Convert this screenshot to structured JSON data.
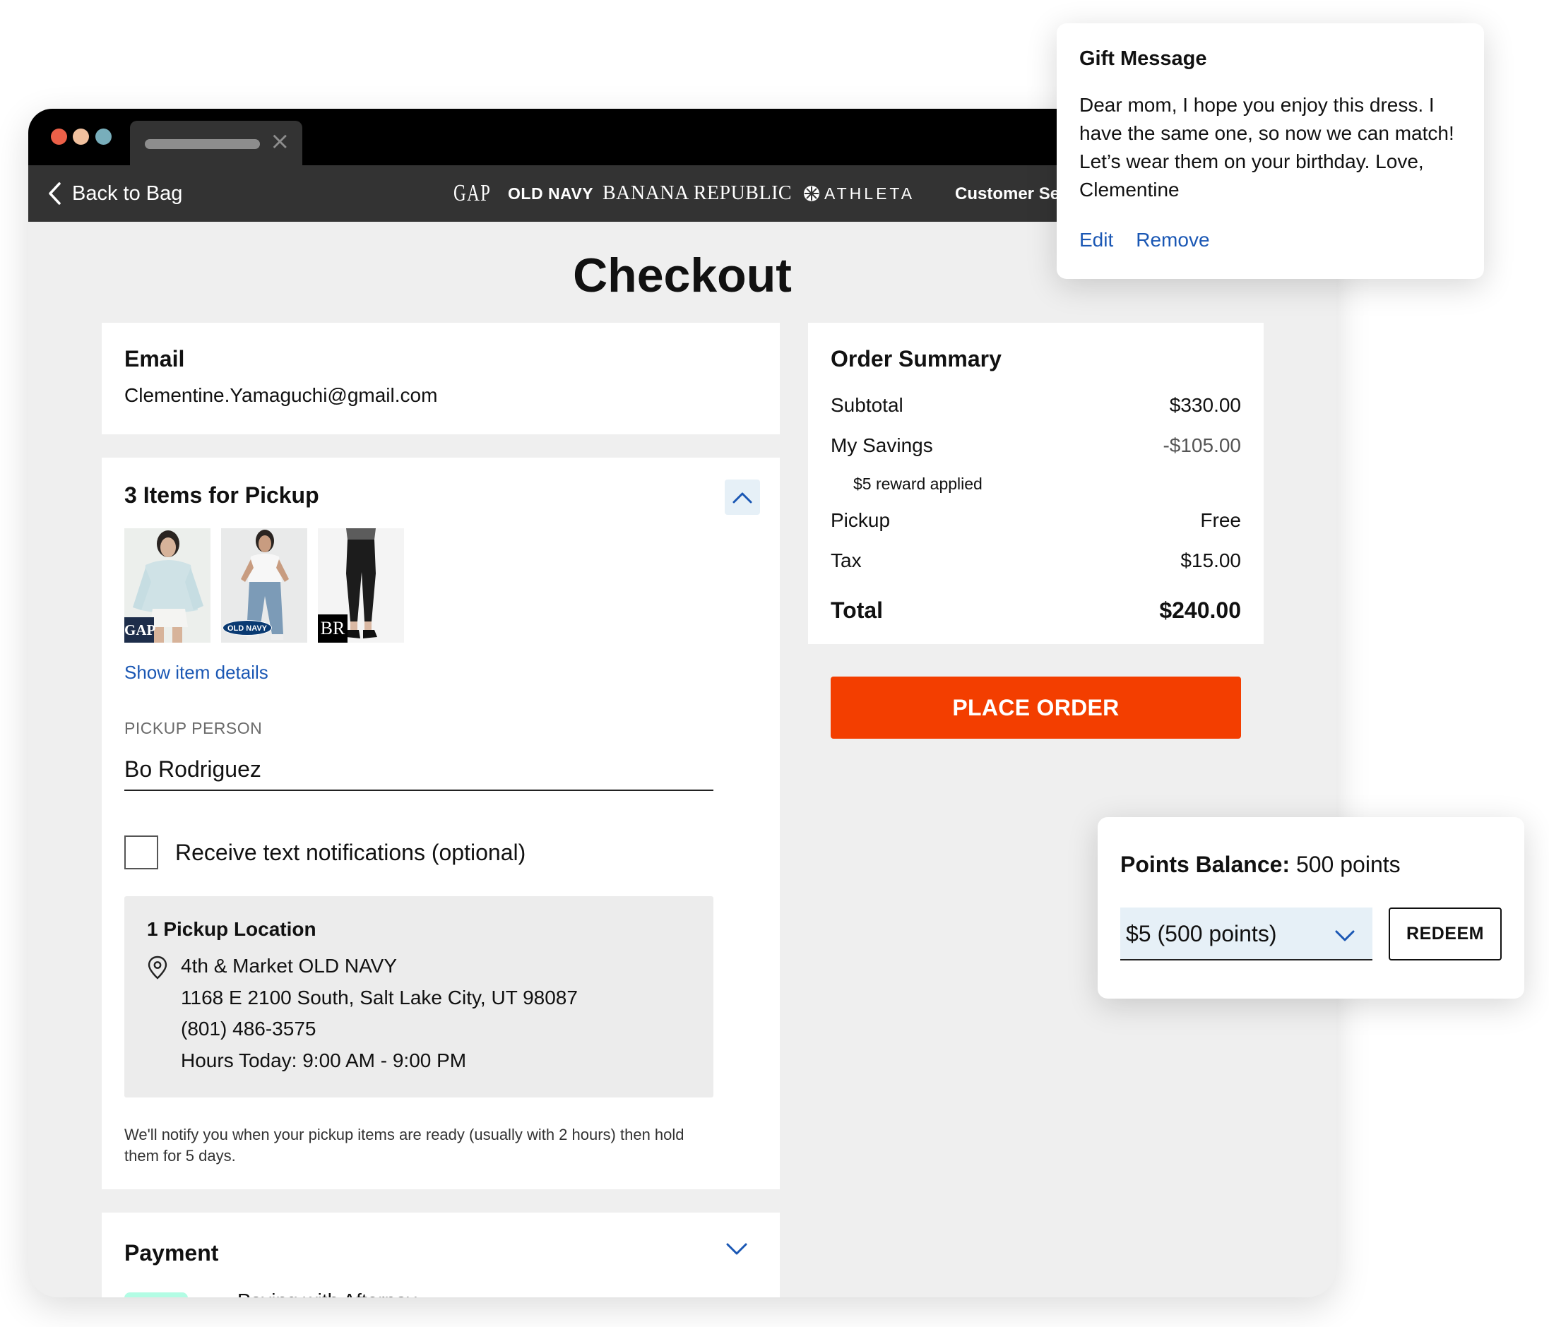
{
  "browser": {
    "tab_close_icon": "close-icon"
  },
  "nav": {
    "back_label": "Back to Bag",
    "brands": {
      "gap": "GAP",
      "old_navy": "OLD NAVY",
      "banana_republic": "BANANA REPUBLIC",
      "athleta": "ATHLETA"
    },
    "customer_service": "Customer Ser"
  },
  "page": {
    "title": "Checkout"
  },
  "email": {
    "heading": "Email",
    "value": "Clementine.Yamaguchi@gmail.com"
  },
  "pickup": {
    "heading": "3 Items for Pickup",
    "items": [
      {
        "brand_badge": "GAP"
      },
      {
        "brand_badge": "OLD NAVY"
      },
      {
        "brand_badge": "BR"
      }
    ],
    "show_details": "Show item details",
    "person_label": "PICKUP PERSON",
    "person_value": "Bo Rodriguez",
    "text_notifications_label": "Receive text notifications (optional)",
    "text_notifications_checked": false,
    "location": {
      "title": "1 Pickup Location",
      "store": "4th & Market OLD NAVY",
      "address": "1168 E 2100 South, Salt Lake City, UT 98087",
      "phone": "(801) 486-3575",
      "hours": "Hours Today: 9:00 AM - 9:00 PM"
    },
    "notice": "We'll notify you when your pickup items are ready (usually with 2 hours) then hold them for 5 days."
  },
  "payment": {
    "heading": "Payment",
    "afterpay_logo": "afterpay",
    "method": "Paying with Afterpay"
  },
  "summary": {
    "heading": "Order Summary",
    "subtotal_label": "Subtotal",
    "subtotal_value": "$330.00",
    "savings_label": "My Savings",
    "savings_value": "-$105.00",
    "reward_note": "$5 reward applied",
    "pickup_label": "Pickup",
    "pickup_value": "Free",
    "tax_label": "Tax",
    "tax_value": "$15.00",
    "total_label": "Total",
    "total_value": "$240.00"
  },
  "place_order": "PLACE ORDER",
  "gift": {
    "heading": "Gift Message",
    "message": "Dear mom, I hope you enjoy this dress. I have the same one, so now we can match! Let’s wear them on your birthday. Love, Clementine",
    "edit": "Edit",
    "remove": "Remove"
  },
  "points": {
    "label": "Points Balance:",
    "value": "500 points",
    "selected_option": "$5 (500 points)",
    "redeem": "REDEEM"
  },
  "colors": {
    "primary_cta": "#f33e00",
    "link": "#1a57b4",
    "nav_bg": "#333333",
    "page_bg": "#efefef",
    "select_bg": "#e6f0f7",
    "afterpay_mint": "#b2fce4"
  }
}
